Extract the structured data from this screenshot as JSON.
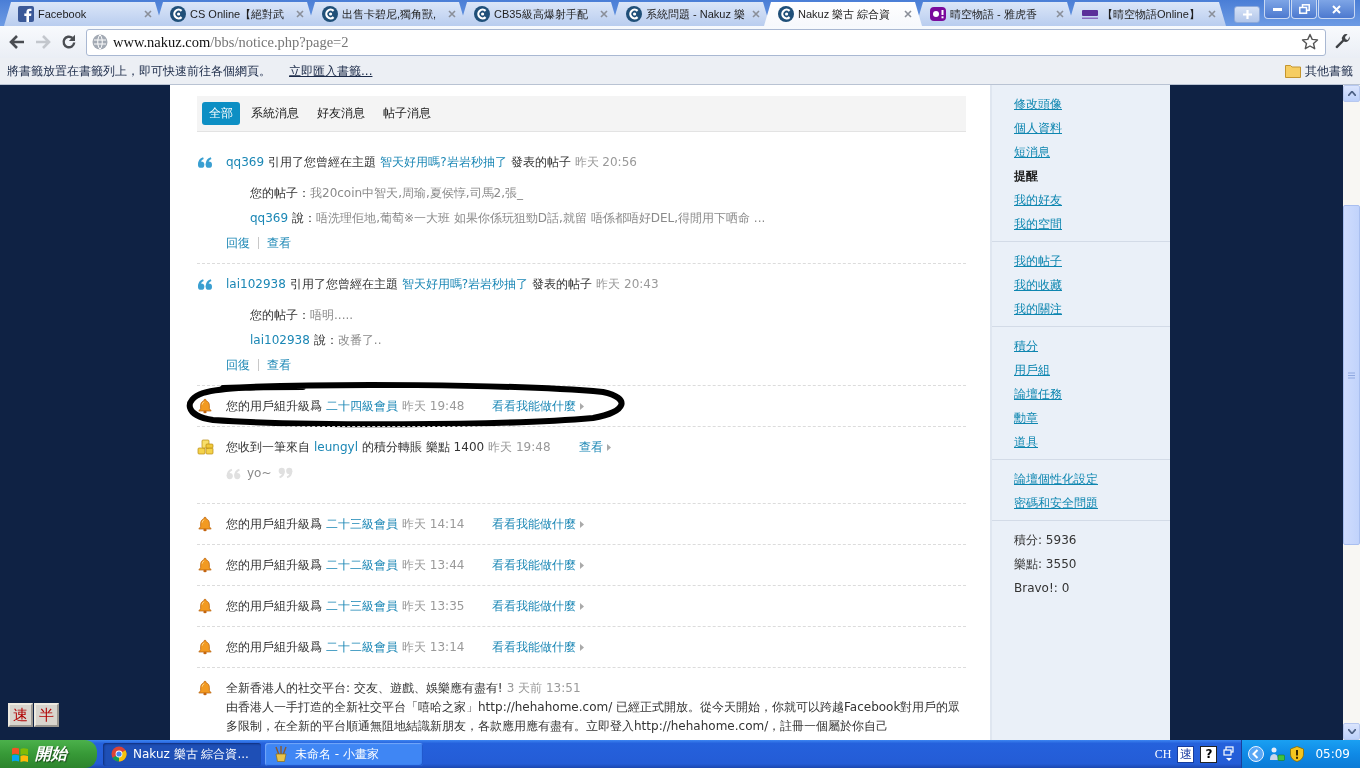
{
  "browser": {
    "tabs": [
      {
        "kind": "facebook",
        "title": "Facebook",
        "selected": false
      },
      {
        "kind": "site",
        "title": "CS Online【絕對武",
        "selected": false
      },
      {
        "kind": "site",
        "title": "出售卡碧尼,獨角獸,",
        "selected": false
      },
      {
        "kind": "site",
        "title": "CB35級高爆射手配",
        "selected": false
      },
      {
        "kind": "site",
        "title": "系統問題 - Nakuz 樂",
        "selected": false
      },
      {
        "kind": "site",
        "title": "Nakuz 樂古 綜合資",
        "selected": true
      },
      {
        "kind": "yahoo",
        "title": "晴空物語 - 雅虎香",
        "selected": false
      },
      {
        "kind": "alta",
        "title": "【晴空物語Online】",
        "selected": false
      }
    ],
    "back_disabled": false,
    "forward_disabled": true,
    "url_host": "www.nakuz.com",
    "url_path": "/bbs/notice.php?page=2"
  },
  "bookmarks_bar": {
    "hint": "將書籤放置在書籤列上，即可快速前往各個網頁。",
    "import_link": "立即匯入書籤...",
    "other_bookmarks": "其他書籤"
  },
  "notice_tabs": [
    {
      "label": "全部",
      "selected": true
    },
    {
      "label": "系統消息",
      "selected": false
    },
    {
      "label": "好友消息",
      "selected": false
    },
    {
      "label": "帖子消息",
      "selected": false
    }
  ],
  "notices": [
    {
      "kind": "quote",
      "circled": false,
      "user": "qq369",
      "action": "引用了您曾經在主題",
      "topic": "智天好用嗎?岩岩秒抽了",
      "suffix": "發表的帖子",
      "time": "昨天 20:56",
      "post_label": "您的帖子：",
      "post": "我20coin中智天,周瑜,夏侯惇,司馬2,張_",
      "reply_user": "qq369",
      "says": "說：",
      "reply": "唔洗理佢地,葡萄※一大班 如果你係玩狙勁D話,就留 唔係都唔好DEL,得閒用下哂命 ...",
      "actions": [
        "回復",
        "查看"
      ]
    },
    {
      "kind": "quote",
      "circled": false,
      "user": "lai102938",
      "action": "引用了您曾經在主題",
      "topic": "智天好用嗎?岩岩秒抽了",
      "suffix": "發表的帖子",
      "time": "昨天 20:43",
      "post_label": "您的帖子：",
      "post": "唔明.....",
      "reply_user": "lai102938",
      "says": "說：",
      "reply": "改番了..",
      "actions": [
        "回復",
        "查看"
      ]
    },
    {
      "kind": "upgrade",
      "circled": true,
      "text": "您的用戶組升級爲",
      "group": "二十四級會員",
      "time": "昨天 19:48",
      "link": "看看我能做什麼"
    },
    {
      "kind": "transfer",
      "circled": false,
      "text": "您收到一筆來自",
      "user": "leungyl",
      "detail": "的積分轉賬 樂點 1400",
      "time": "昨天 19:48",
      "link": "查看",
      "message": "yo~"
    },
    {
      "kind": "upgrade",
      "circled": false,
      "text": "您的用戶組升級爲",
      "group": "二十三級會員",
      "time": "昨天 14:14",
      "link": "看看我能做什麼"
    },
    {
      "kind": "upgrade",
      "circled": false,
      "text": "您的用戶組升級爲",
      "group": "二十二級會員",
      "time": "昨天 13:44",
      "link": "看看我能做什麼"
    },
    {
      "kind": "upgrade",
      "circled": false,
      "text": "您的用戶組升級爲",
      "group": "二十三級會員",
      "time": "昨天 13:35",
      "link": "看看我能做什麼"
    },
    {
      "kind": "upgrade",
      "circled": false,
      "text": "您的用戶組升級爲",
      "group": "二十二級會員",
      "time": "昨天 13:14",
      "link": "看看我能做什麼"
    },
    {
      "kind": "announcement",
      "circled": false,
      "title": "全新香港人的社交平台: 交友、遊戲、娛樂應有盡有!",
      "time": "3 天前 13:51",
      "body": "由香港人一手打造的全新社交平台「嘻哈之家」http://hehahome.com/ 已經正式開放。從今天開始，你就可以跨越Facebook對用戶的眾多限制，在全新的平台順通無阻地結識新朋友，各款應用應有盡有。立即登入http://hehahome.com/，註冊一個屬於你自己"
    }
  ],
  "sidebar": {
    "groups": [
      {
        "items": [
          {
            "label": "修改頭像",
            "selected": false
          },
          {
            "label": "個人資料",
            "selected": false
          },
          {
            "label": "短消息",
            "selected": false
          },
          {
            "label": "提醒",
            "selected": true
          },
          {
            "label": "我的好友",
            "selected": false
          },
          {
            "label": "我的空間",
            "selected": false
          }
        ]
      },
      {
        "items": [
          {
            "label": "我的帖子",
            "selected": false
          },
          {
            "label": "我的收藏",
            "selected": false
          },
          {
            "label": "我的關注",
            "selected": false
          }
        ]
      },
      {
        "items": [
          {
            "label": "積分",
            "selected": false
          },
          {
            "label": "用戶組",
            "selected": false
          },
          {
            "label": "論壇任務",
            "selected": false
          },
          {
            "label": "勳章",
            "selected": false
          },
          {
            "label": "道具",
            "selected": false
          }
        ]
      },
      {
        "items": [
          {
            "label": "論壇個性化設定",
            "selected": false
          },
          {
            "label": "密碼和安全問題",
            "selected": false
          }
        ]
      }
    ],
    "stats": [
      "積分: 5936",
      "樂點: 3550",
      "Bravo!: 0"
    ]
  },
  "ime_bar": [
    "速",
    "半"
  ],
  "taskbar": {
    "start": "開始",
    "tasks": [
      {
        "kind": "browser",
        "label": "Nakuz 樂古 綜合資...",
        "selected": true
      },
      {
        "kind": "paint",
        "label": "未命名 - 小畫家",
        "selected": false
      }
    ],
    "language": "CH",
    "ime_mode": "速",
    "help": "?",
    "clock": "05:09"
  }
}
